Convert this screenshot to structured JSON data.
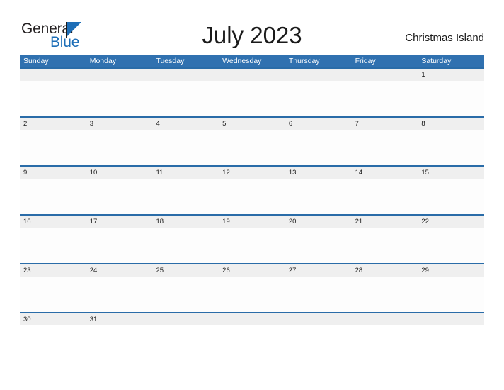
{
  "brand": {
    "name_part1": "General",
    "name_part2": "Blue",
    "flag_icon": "triangle-flag-icon",
    "accent_color": "#1d6eb7",
    "text_color": "#231f20"
  },
  "header": {
    "title": "July 2023",
    "location": "Christmas Island"
  },
  "calendar": {
    "header_color": "#3071b0",
    "date_band_color": "#efefef",
    "separator_color": "#2a6ca8",
    "weekdays": [
      "Sunday",
      "Monday",
      "Tuesday",
      "Wednesday",
      "Thursday",
      "Friday",
      "Saturday"
    ],
    "weeks": [
      {
        "days": [
          "",
          "",
          "",
          "",
          "",
          "",
          "1"
        ]
      },
      {
        "days": [
          "2",
          "3",
          "4",
          "5",
          "6",
          "7",
          "8"
        ]
      },
      {
        "days": [
          "9",
          "10",
          "11",
          "12",
          "13",
          "14",
          "15"
        ]
      },
      {
        "days": [
          "16",
          "17",
          "18",
          "19",
          "20",
          "21",
          "22"
        ]
      },
      {
        "days": [
          "23",
          "24",
          "25",
          "26",
          "27",
          "28",
          "29"
        ]
      },
      {
        "days": [
          "30",
          "31",
          "",
          "",
          "",
          "",
          ""
        ]
      }
    ]
  }
}
